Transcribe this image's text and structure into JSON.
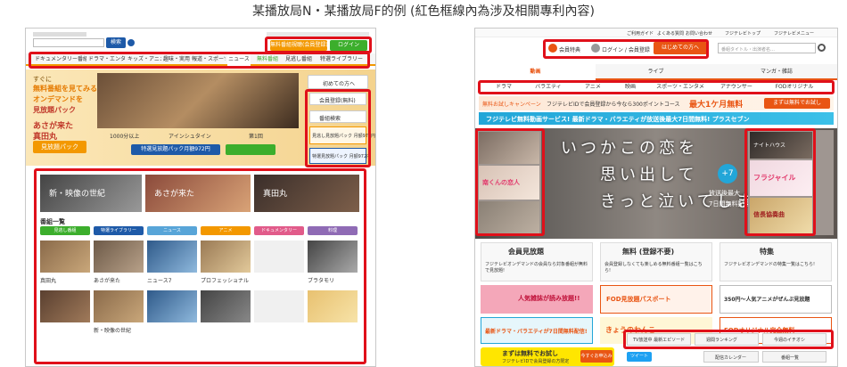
{
  "caption": "某播放局N・某播放局F的例 (紅色框線內為涉及相關專利內容)",
  "colors": {
    "highlight": "#e0101a",
    "left_accent": "#f39800",
    "right_accent": "#e95513",
    "green": "#3cae2c"
  },
  "left": {
    "search_button": "検索",
    "signup_button": "無料番組視聴(会員登録)",
    "login_button": "ログイン",
    "nav_tabs": [
      "ドキュメンタリー番組",
      "ドラマ・エンタメ",
      "キッズ・アニメ",
      "趣味・実用",
      "報道・スポーツ",
      "ニュース",
      "無料番組",
      "見逃し番組",
      "特選ライブラリー"
    ],
    "hero_lines": [
      "すぐに",
      "無料番組を見てみる",
      "オンデマンドを",
      "見放題パック",
      "あさが来た",
      "真田丸",
      "見放題パック"
    ],
    "hero_caption_1": "1000分以上",
    "hero_caption_2": "アインシュタイン",
    "hero_caption_3": "第1回",
    "hero_badge": "特選見放題パック月額972円",
    "side_buttons": [
      "初めての方へ",
      "会員登録(無料)",
      "番組検索",
      "見逃し見放題パック 月額972円",
      "特選見放題パック 月額972円"
    ],
    "banner_1": "新・映像の世紀",
    "banner_2": "あさが来た",
    "banner_3": "真田丸",
    "list_title": "番組一覧",
    "list_columns": [
      "見逃し番組",
      "特選ライブラリー",
      "ニュース",
      "アニメ",
      "ドキュメンタリー",
      "料理"
    ],
    "list_items": [
      "真田丸",
      "あさが来た",
      "ニュース7",
      "プロフェッショナル",
      "ブラタモリ",
      "新・映像の世紀"
    ]
  },
  "right": {
    "top_links": [
      "ご利用ガイド",
      "よくある質問",
      "お問い合わせ",
      "フジテレビトップ",
      "フジテレビメニュー"
    ],
    "member_button": "会員特典",
    "login_label": "ログイン / 会員登録",
    "start_button": "はじめての方へ",
    "search_placeholder": "番組タイトル・出演者名…",
    "main_tabs": [
      "動画",
      "ライブ",
      "マンガ・雑誌"
    ],
    "sub_tabs": [
      "ドラマ",
      "バラエティ",
      "アニメ",
      "映画",
      "スポーツ・エンタメ",
      "アナウンサー",
      "FODオリジナル"
    ],
    "promo_1": "無料お試しキャンペーン",
    "promo_2": "フジテレビIDで会員登録から今なら300ポイントコース",
    "promo_3": "最大1ケ月無料",
    "promo_4": "まずは無料でお試し",
    "promo_5": "フジテレビ無料動画サービス! 最新ドラマ・バラエティが放送後最大7日間無料! プラスセブン",
    "hero_text": [
      "いつかこの恋を",
      "思い出して",
      "きっと泣いてしまう"
    ],
    "hero_sub": "放送後最大",
    "hero_sub2": "7日間無料配信",
    "hero_plus": "+7",
    "left_thumb_1": "南くんの恋人",
    "right_thumb_1": "ナイトハウス",
    "right_thumb_2": "フラジャイル",
    "right_thumb_3": "信長協奏曲",
    "cat_1": "会員見放題",
    "cat_2": "無料 (登録不要)",
    "cat_3": "特集",
    "cat_1_desc": "フジテレビオンデマンドの会員なら対象番組が無料で見放題!",
    "cat_2_desc": "会員登録しなくても楽しめる無料番組一覧はこちら!",
    "cat_3_desc": "フジテレビオンデマンドの特集一覧はこちら!",
    "grid_1": "人気雑誌が読み放題!!",
    "grid_2": "FOD見放題パスポート",
    "grid_3": "350円〜人気アニメがぜんぶ見放題",
    "grid_4": "最新ドラマ・バラエティが7日間無料配信!",
    "grid_5": "きょうのわんこ",
    "grid_6": "FODオリジナル完全無料",
    "trial_title": "まずは無料でお試し",
    "trial_desc": "フジテレビIDで会員登録の方限定",
    "trial_badge": "今すぐお申込み",
    "rank_1": "TV放送中 最新エピソード",
    "rank_2": "週間ランキング",
    "rank_3": "今週のイチオシ",
    "share_label": "ツイート",
    "calendar": "配信カレンダー",
    "list": "番組一覧"
  }
}
